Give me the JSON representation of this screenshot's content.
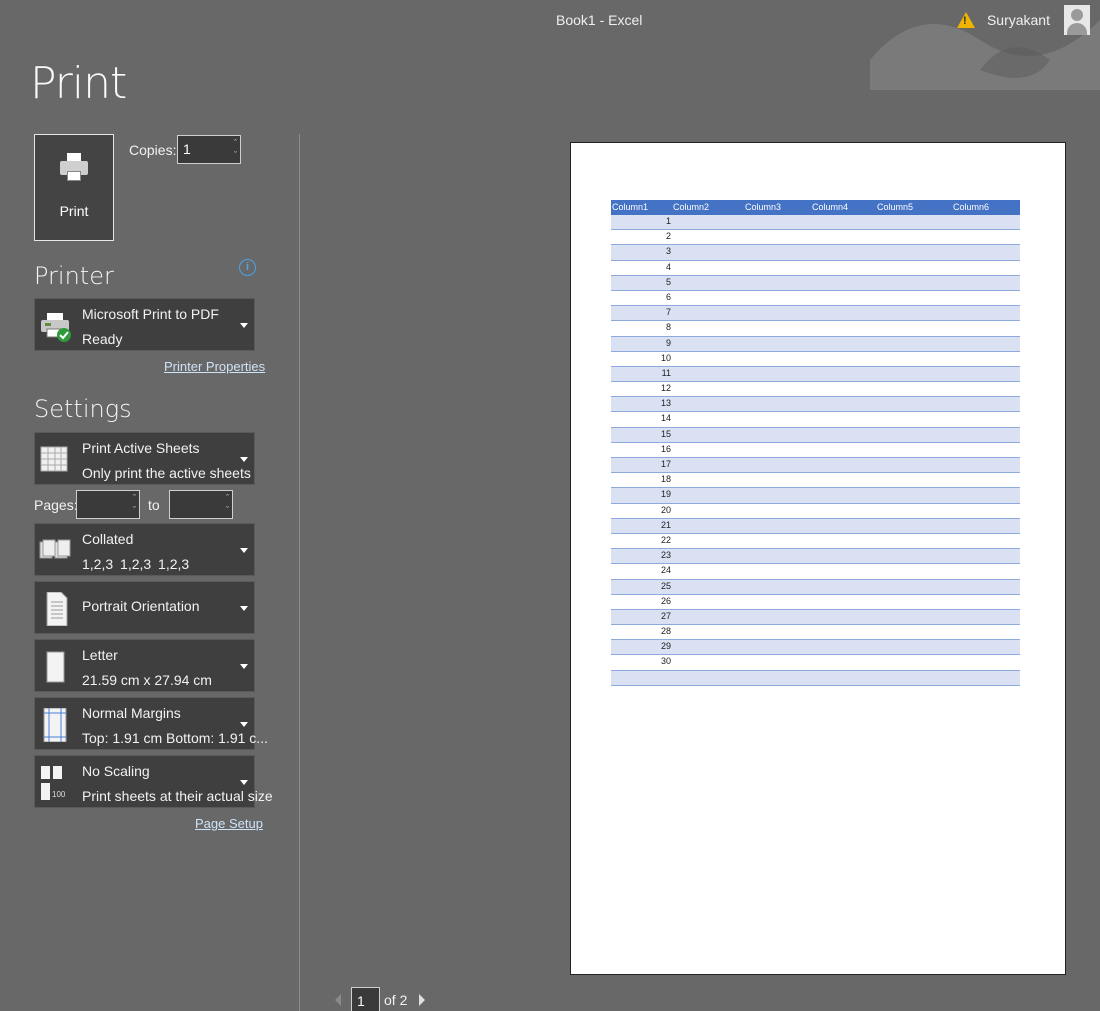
{
  "window": {
    "title": "Book1  -  Excel",
    "user": "Suryakant"
  },
  "page": {
    "title": "Print"
  },
  "print_button": {
    "label": "Print"
  },
  "copies": {
    "label": "Copies:",
    "value": "1"
  },
  "printer": {
    "heading": "Printer",
    "name": "Microsoft Print to PDF",
    "status": "Ready",
    "properties_link": "Printer Properties"
  },
  "settings": {
    "heading": "Settings",
    "what": {
      "title": "Print Active Sheets",
      "subtitle": "Only print the active sheets"
    },
    "pages": {
      "label": "Pages:",
      "to_label": "to",
      "from": "",
      "to": ""
    },
    "collation": {
      "title": "Collated",
      "subtitle": "1,2,3    1,2,3    1,2,3"
    },
    "orientation": {
      "title": "Portrait Orientation"
    },
    "paper": {
      "title": "Letter",
      "subtitle": "21.59 cm x 27.94 cm"
    },
    "margins": {
      "title": "Normal Margins",
      "subtitle": "Top: 1.91 cm Bottom: 1.91 c..."
    },
    "scaling": {
      "title": "No Scaling",
      "subtitle": "Print sheets at their actual size",
      "icon_text": "100"
    },
    "page_setup_link": "Page Setup"
  },
  "preview": {
    "columns": [
      "Column1",
      "Column2",
      "Column3",
      "Column4",
      "Column5",
      "Column6"
    ],
    "rows": [
      "1",
      "2",
      "3",
      "4",
      "5",
      "6",
      "7",
      "8",
      "9",
      "10",
      "11",
      "12",
      "13",
      "14",
      "15",
      "16",
      "17",
      "18",
      "19",
      "20",
      "21",
      "22",
      "23",
      "24",
      "25",
      "26",
      "27",
      "28",
      "29",
      "30",
      ""
    ]
  },
  "pager": {
    "current": "1",
    "of_label": "of 2"
  },
  "colors": {
    "background": "#686868",
    "table_header": "#4472c4",
    "table_band": "#d9e1f2",
    "link": "#cfe3f7",
    "info": "#4aa3e8"
  }
}
